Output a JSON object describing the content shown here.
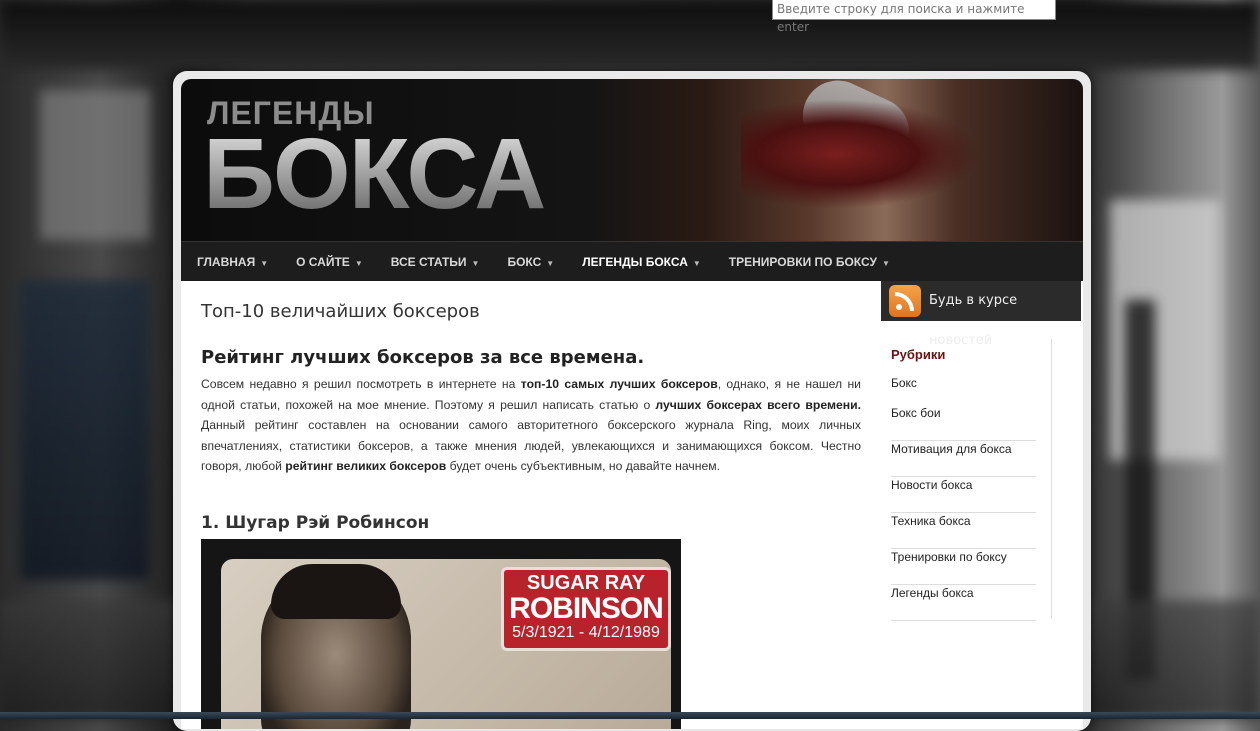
{
  "search": {
    "placeholder": "Введите строку для поиска и нажмите enter"
  },
  "header": {
    "logo_small": "ЛЕГЕНДЫ",
    "logo_big": "БОКСА"
  },
  "nav": {
    "items": [
      {
        "label": "ГЛАВНАЯ"
      },
      {
        "label": "О САЙТЕ"
      },
      {
        "label": "ВСЕ СТАТЬИ"
      },
      {
        "label": "БОКС"
      },
      {
        "label": "ЛЕГЕНДЫ БОКСА",
        "active": true
      },
      {
        "label": "ТРЕНИРОВКИ ПО БОКСУ"
      }
    ],
    "caret": "▼"
  },
  "post": {
    "title": "Топ-10 величайших боксеров",
    "h2": "Рейтинг лучших боксеров за все времена.",
    "para": {
      "t1": "Совсем недавно я решил посмотреть в интернете на ",
      "b1": "топ-10 самых лучших боксеров",
      "t2": ", однако, я не нашел ни одной статьи, похожей на мое мнение. Поэтому я решил написать статью о ",
      "b2": "лучших боксерах всего времени.",
      "t3": " Данный рейтинг составлен на основании самого авторитетного боксерского журнала Ring, моих личных впечатлениях, статистики боксеров, а также мнения людей, увлекающихся и занимающихся боксом. Честно говоря,  любой ",
      "b3": "рейтинг великих боксеров",
      "t4": " будет очень субъективным, но давайте начнем."
    },
    "h3": "1. Шугар Рэй Робинсон",
    "photo_badge": {
      "line1": "SUGAR RAY",
      "line2": "ROBINSON",
      "line3": "5/3/1921 - 4/12/1989"
    }
  },
  "sidebar": {
    "rss_label": "Будь в курсе новостей",
    "rubrics_title": "Рубрики",
    "rubrics": [
      "Бокс",
      "Бокс бои",
      "Мотивация для бокса",
      "Новости бокса",
      "Техника бокса",
      "Тренировки по боксу",
      "Легенды бокса"
    ]
  },
  "colors": {
    "nav_bg": "#1d1d1d",
    "rubric_title": "#6a1313",
    "rss_orange": "#e07420"
  },
  "icons": {
    "rss": "rss-icon",
    "caret": "chevron-down-icon"
  }
}
